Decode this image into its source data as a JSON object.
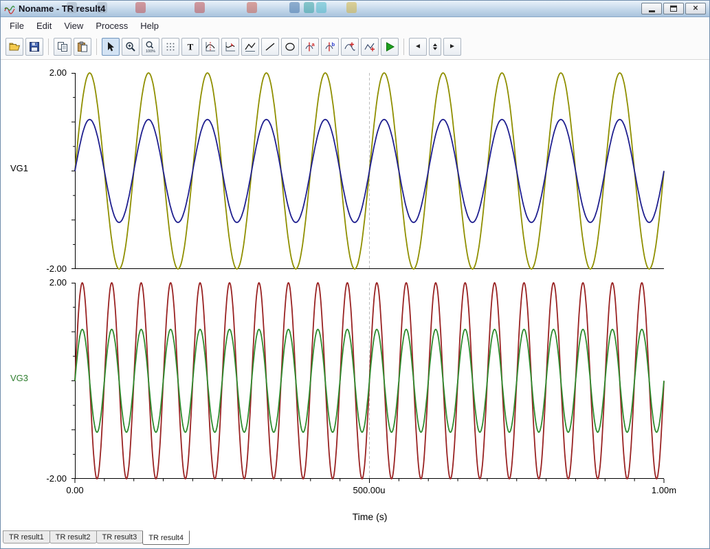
{
  "window": {
    "title": "Noname - TR result4",
    "controls": {
      "close_glyph": "✕"
    }
  },
  "titlebar_ghosts": [
    {
      "x": 96,
      "color": "#9aa8b8"
    },
    {
      "x": 140,
      "color": "#9aa8b8"
    },
    {
      "x": 196,
      "color": "#c04545"
    },
    {
      "x": 282,
      "color": "#c04545"
    },
    {
      "x": 358,
      "color": "#cc5544"
    },
    {
      "x": 420,
      "color": "#3a6ea5"
    },
    {
      "x": 441,
      "color": "#2a9d9d"
    },
    {
      "x": 459,
      "color": "#46b8c8"
    },
    {
      "x": 503,
      "color": "#d4b236"
    }
  ],
  "menu": {
    "items": [
      "File",
      "Edit",
      "View",
      "Process",
      "Help"
    ]
  },
  "toolbar": {
    "buttons": [
      {
        "name": "open-file-button",
        "icon": "folder"
      },
      {
        "name": "save-button",
        "icon": "floppy"
      },
      {
        "name": "separator"
      },
      {
        "name": "copy-button",
        "icon": "copy"
      },
      {
        "name": "paste-button",
        "icon": "paste"
      },
      {
        "name": "separator"
      },
      {
        "name": "pointer-tool-button",
        "icon": "pointer",
        "pressed": true
      },
      {
        "name": "zoom-in-button",
        "icon": "zoom_in"
      },
      {
        "name": "zoom-100-button",
        "icon": "zoom_100",
        "glyph": "100%"
      },
      {
        "name": "grid-toggle-button",
        "icon": "grid_dots"
      },
      {
        "name": "text-tool-button",
        "icon": "text",
        "glyph": "T"
      },
      {
        "name": "cursor-a-tool-button",
        "icon": "graph_cursor"
      },
      {
        "name": "cursor-b-tool-button",
        "icon": "graph_cursor2"
      },
      {
        "name": "auto-scale-button",
        "icon": "roof"
      },
      {
        "name": "line-tool-button",
        "icon": "line"
      },
      {
        "name": "ellipse-tool-button",
        "icon": "ellipse"
      },
      {
        "name": "marker-a-button",
        "icon": "marker",
        "glyph": "a",
        "glyph_color": "#cc2222"
      },
      {
        "name": "marker-b-button",
        "icon": "marker",
        "glyph": "b",
        "glyph_color": "#2233cc"
      },
      {
        "name": "interpolate-button",
        "icon": "curve_plus"
      },
      {
        "name": "add-curve-button",
        "icon": "curve_plus2"
      },
      {
        "name": "run-button",
        "icon": "play"
      },
      {
        "name": "separator"
      },
      {
        "name": "prev-page-button",
        "icon": "glyph",
        "glyph": "◄"
      },
      {
        "name": "page-spinner",
        "icon": "spinner"
      },
      {
        "name": "next-page-button",
        "icon": "glyph",
        "glyph": "►"
      }
    ]
  },
  "chart_data": [
    {
      "type": "line",
      "ylabel": "VG1",
      "ylabel_color": "#000000",
      "xlim_seconds": [
        0,
        0.001
      ],
      "ylim": [
        -2,
        2
      ],
      "y_tick_labels": [
        "2.00",
        "-2.00"
      ],
      "y_tick_step": 0.5,
      "center_gridline": true,
      "x_ticks_bottom": false,
      "series": [
        {
          "name": "olive-sine",
          "color": "#8f8f00",
          "waveform": "sine",
          "amplitude": 2.0,
          "cycles_per_window": 10,
          "frequency_hz": 10000,
          "phase_deg": 0
        },
        {
          "name": "navy-sine",
          "color": "#1f1f8f",
          "waveform": "sine",
          "amplitude": 1.05,
          "cycles_per_window": 10,
          "frequency_hz": 10000,
          "phase_deg": 0
        }
      ]
    },
    {
      "type": "line",
      "ylabel": "VG3",
      "ylabel_color": "#2e7d2e",
      "xlim_seconds": [
        0,
        0.001
      ],
      "ylim": [
        -2,
        2
      ],
      "y_tick_labels": [
        "2.00",
        "-2.00"
      ],
      "y_tick_step": 0.5,
      "center_gridline": true,
      "x_ticks_bottom": true,
      "xlabel": "Time (s)",
      "x_tick_labels": [
        "0.00",
        "500.00u",
        "1.00m"
      ],
      "series": [
        {
          "name": "darkred-sine",
          "color": "#992222",
          "waveform": "sine",
          "amplitude": 2.0,
          "cycles_per_window": 20,
          "frequency_hz": 20000,
          "phase_deg": 0
        },
        {
          "name": "green-sine",
          "color": "#2e8b2e",
          "waveform": "sine",
          "amplitude": 1.05,
          "cycles_per_window": 20,
          "frequency_hz": 20000,
          "phase_deg": 0
        }
      ]
    }
  ],
  "tabs": [
    {
      "label": "TR result1",
      "active": false
    },
    {
      "label": "TR result2",
      "active": false
    },
    {
      "label": "TR result3",
      "active": false
    },
    {
      "label": "TR result4",
      "active": true
    }
  ]
}
